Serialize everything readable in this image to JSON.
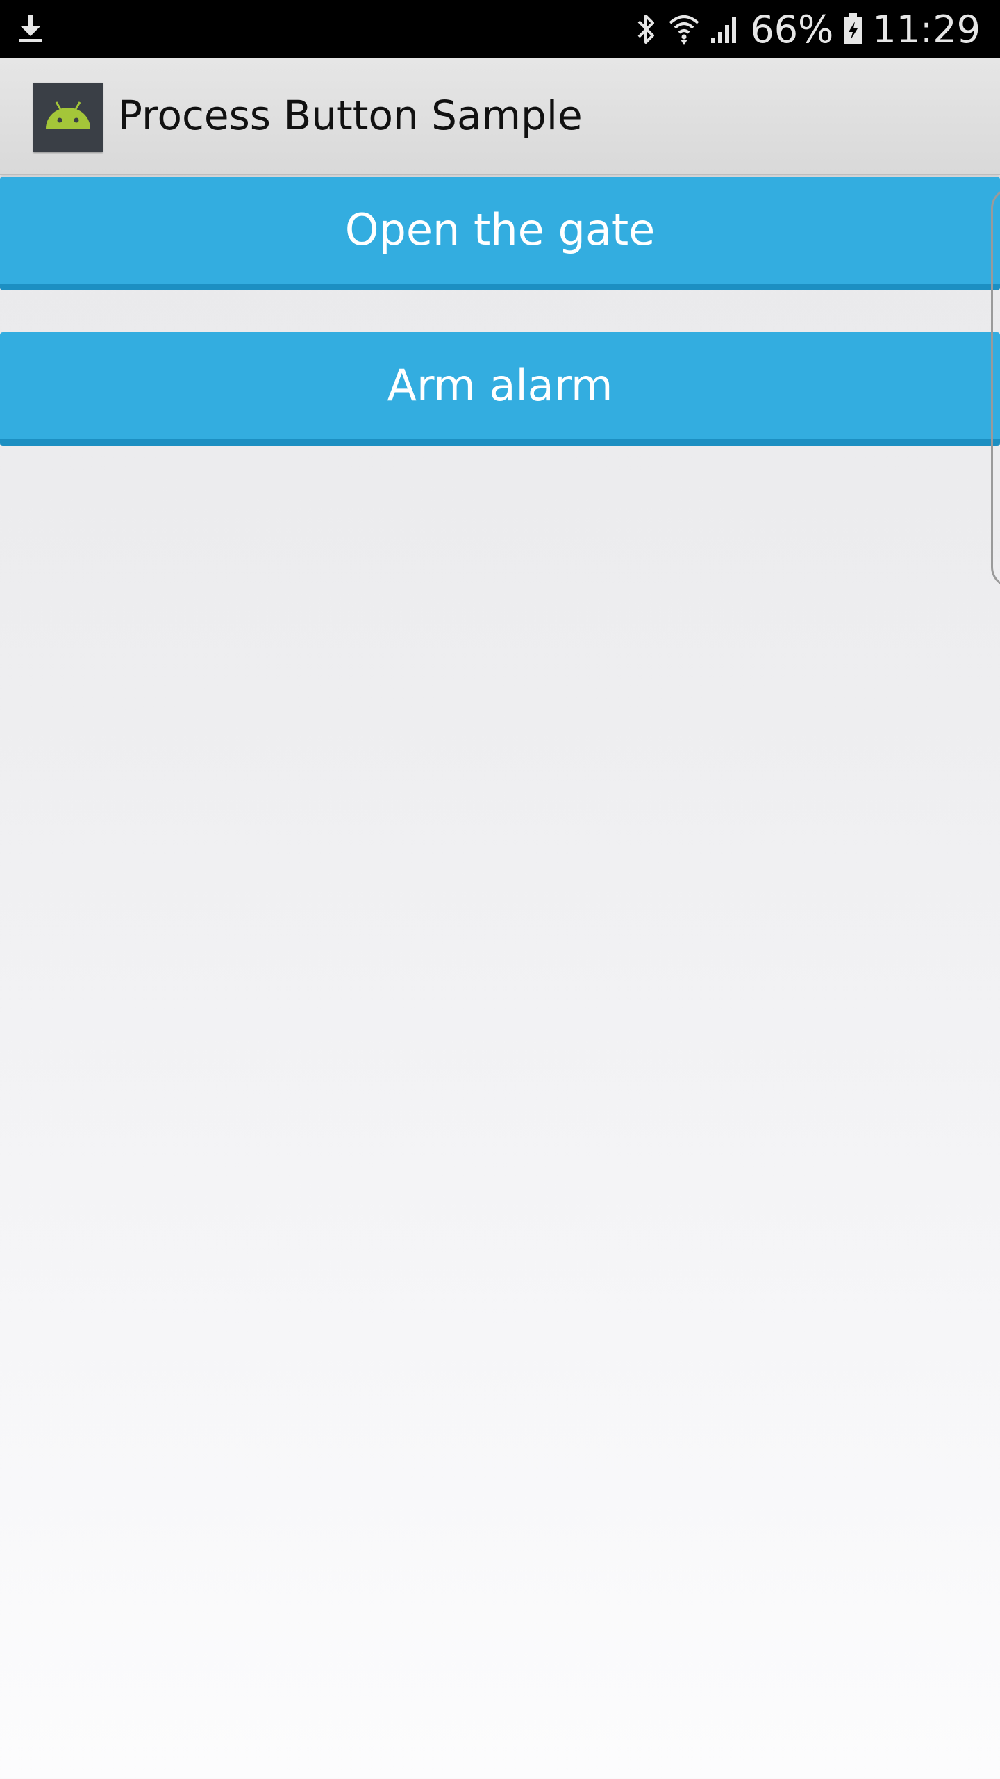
{
  "status_bar": {
    "download_icon": "download-icon",
    "bluetooth_icon": "bluetooth-icon",
    "wifi_icon": "wifi-icon",
    "signal_icon": "signal-icon",
    "battery_percent": "66%",
    "battery_icon": "battery-charging-icon",
    "time": "11:29"
  },
  "action_bar": {
    "app_icon": "android-icon",
    "title": "Process Button Sample"
  },
  "buttons": [
    {
      "label": "Open the gate"
    },
    {
      "label": "Arm alarm"
    }
  ],
  "colors": {
    "button": "#33ADE0",
    "button_border": "#1C8FC2",
    "android_green": "#A4C639"
  }
}
